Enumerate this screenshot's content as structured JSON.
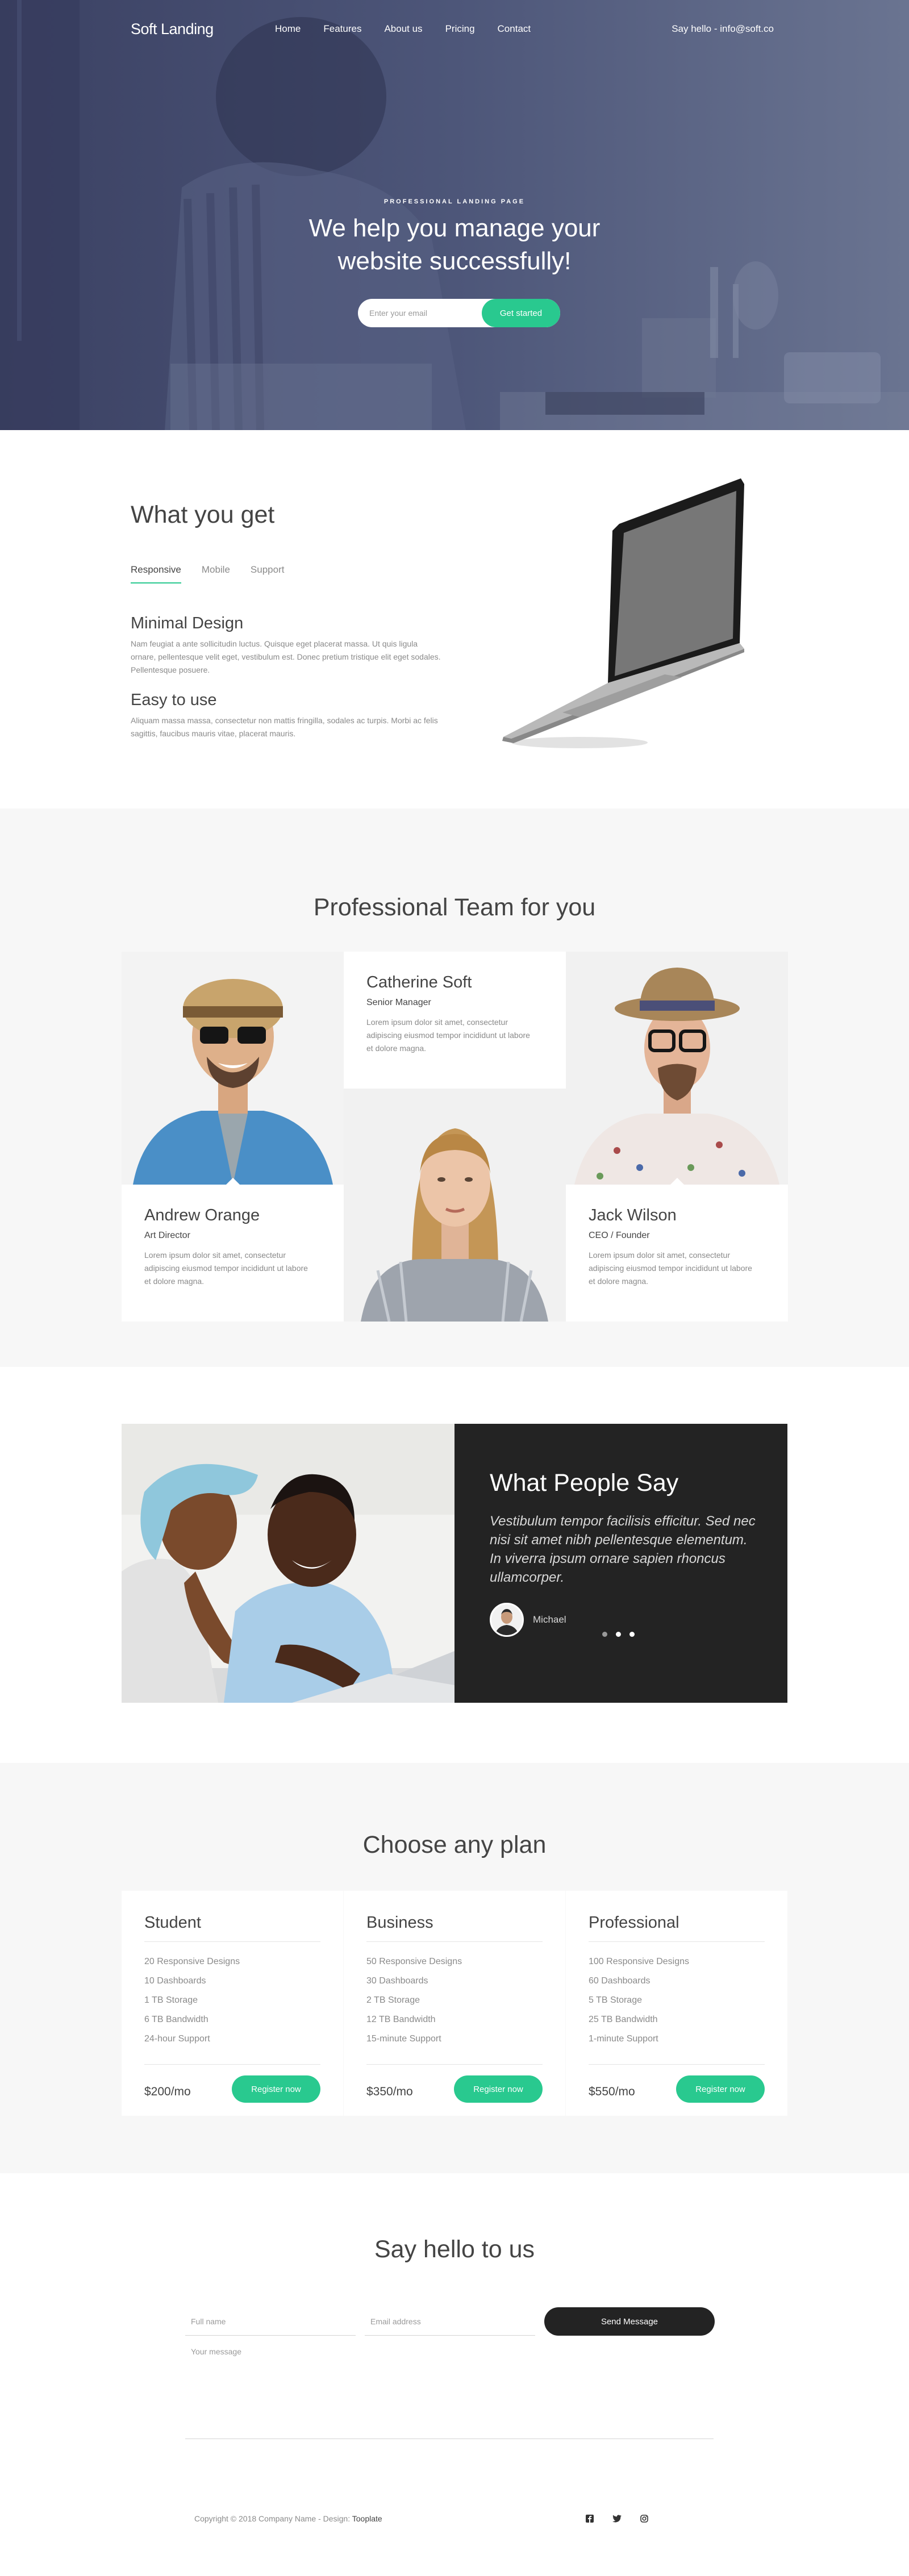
{
  "nav": {
    "brand": "Soft Landing",
    "links": [
      "Home",
      "Features",
      "About us",
      "Pricing",
      "Contact"
    ],
    "hello": "Say hello - info@soft.co"
  },
  "hero": {
    "kicker": "PROFESSIONAL LANDING PAGE",
    "title_line1": "We help you manage your",
    "title_line2": "website successfully!",
    "email_placeholder": "Enter your email",
    "cta": "Get started"
  },
  "features": {
    "title": "What you get",
    "tabs": [
      "Responsive",
      "Mobile",
      "Support"
    ],
    "items": [
      {
        "title": "Minimal Design",
        "text": "Nam feugiat a ante sollicitudin luctus. Quisque eget placerat massa. Ut quis ligula ornare, pellentesque velit eget, vestibulum est. Donec pretium tristique elit eget sodales. Pellentesque posuere."
      },
      {
        "title": "Easy to use",
        "text": "Aliquam massa massa, consectetur non mattis fringilla, sodales ac turpis. Morbi ac felis sagittis, faucibus mauris vitae, placerat mauris."
      }
    ]
  },
  "team": {
    "title": "Professional Team for you",
    "members": [
      {
        "name": "Andrew Orange",
        "role": "Art Director",
        "desc": "Lorem ipsum dolor sit amet, consectetur adipiscing eiusmod tempor incididunt ut labore et dolore magna."
      },
      {
        "name": "Catherine Soft",
        "role": "Senior Manager",
        "desc": "Lorem ipsum dolor sit amet, consectetur adipiscing eiusmod tempor incididunt ut labore et dolore magna."
      },
      {
        "name": "Jack Wilson",
        "role": "CEO / Founder",
        "desc": "Lorem ipsum dolor sit amet, consectetur adipiscing eiusmod tempor incididunt ut labore et dolore magna."
      }
    ]
  },
  "testimonial": {
    "title": "What People Say",
    "quote": "Vestibulum tempor facilisis efficitur. Sed nec nisi sit amet nibh pellentesque elementum. In viverra ipsum ornare sapien rhoncus ullamcorper.",
    "author": "Michael"
  },
  "pricing": {
    "title": "Choose any plan",
    "plans": [
      {
        "name": "Student",
        "features": [
          "20 Responsive Designs",
          "10 Dashboards",
          "1 TB Storage",
          "6 TB Bandwidth",
          "24-hour Support"
        ],
        "price": "$200/mo",
        "cta": "Register now"
      },
      {
        "name": "Business",
        "features": [
          "50 Responsive Designs",
          "30 Dashboards",
          "2 TB Storage",
          "12 TB Bandwidth",
          "15-minute Support"
        ],
        "price": "$350/mo",
        "cta": "Register now"
      },
      {
        "name": "Professional",
        "features": [
          "100 Responsive Designs",
          "60 Dashboards",
          "5 TB Storage",
          "25 TB Bandwidth",
          "1-minute Support"
        ],
        "price": "$550/mo",
        "cta": "Register now"
      }
    ]
  },
  "contact": {
    "title": "Say hello to us",
    "name_placeholder": "Full name",
    "email_placeholder": "Email address",
    "message_placeholder": "Your message",
    "send": "Send Message"
  },
  "footer": {
    "copyright": "Copyright © 2018 Company Name - Design: ",
    "designer": "Tooplate"
  },
  "icons": {
    "social": [
      "facebook-icon",
      "twitter-icon",
      "instagram-icon"
    ]
  },
  "colors": {
    "accent": "#29c98f",
    "dark": "#232323",
    "hero_overlay": "#4c5478"
  }
}
